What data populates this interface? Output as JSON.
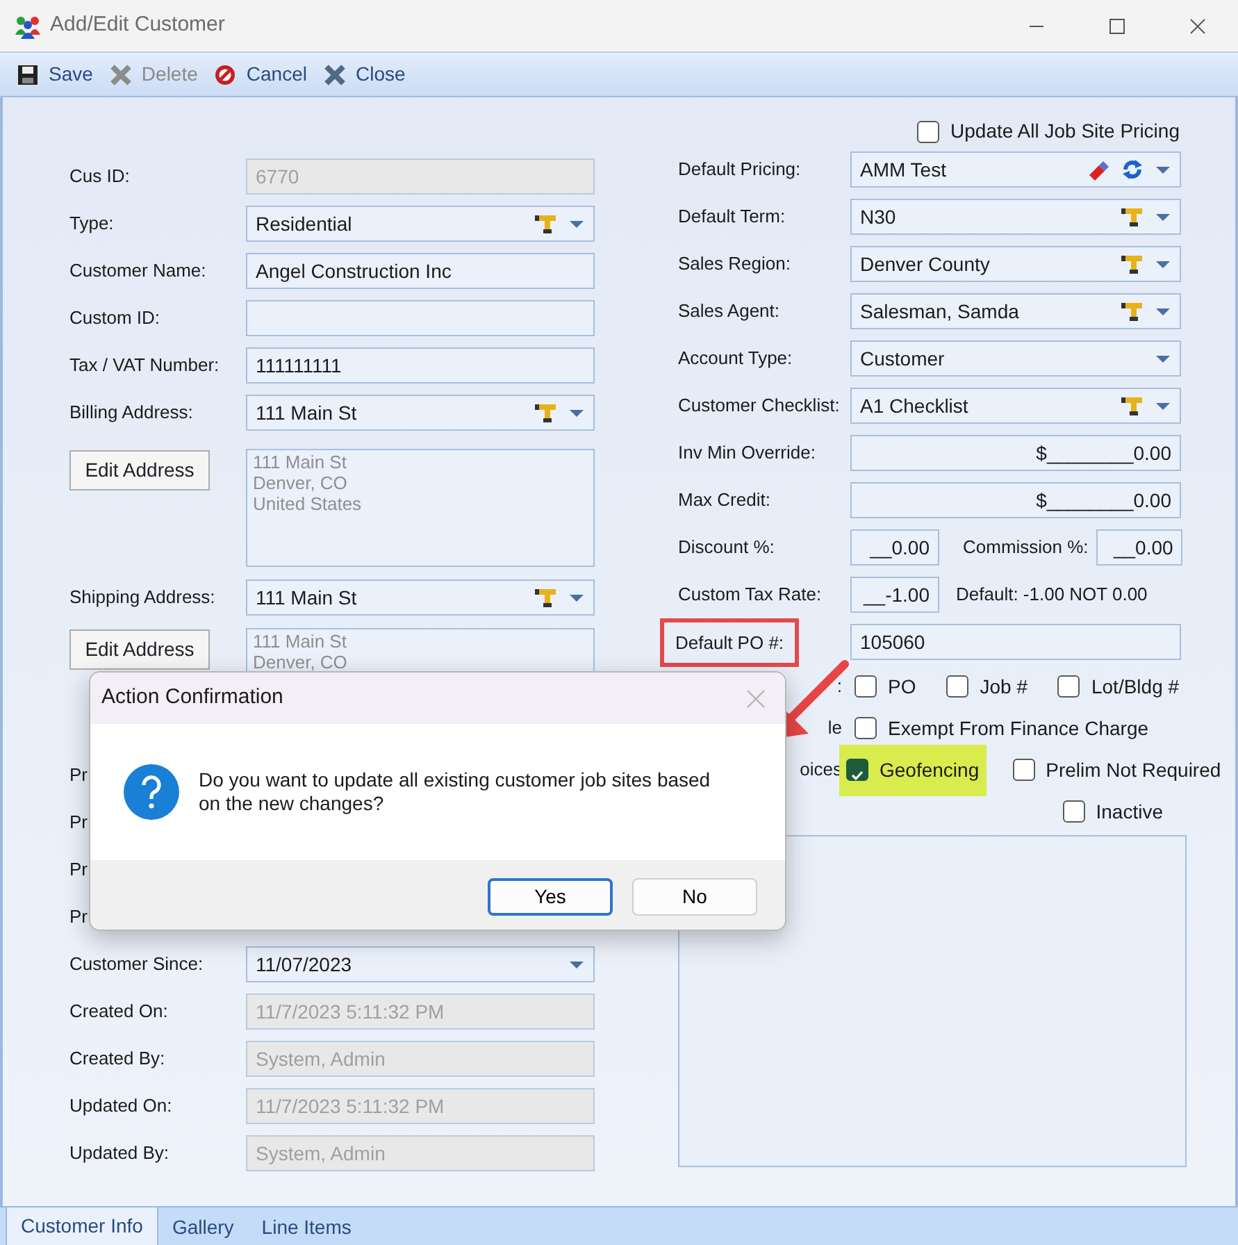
{
  "window": {
    "title": "Add/Edit Customer"
  },
  "toolbar": [
    {
      "label": "Save",
      "kind": "save",
      "disabled": false
    },
    {
      "label": "Delete",
      "kind": "delete",
      "disabled": true
    },
    {
      "label": "Cancel",
      "kind": "cancel",
      "disabled": false
    },
    {
      "label": "Close",
      "kind": "close",
      "disabled": false
    }
  ],
  "left_fields": [
    {
      "label": "Cus ID:",
      "kind": "readonly",
      "value": "6770"
    },
    {
      "label": "Type:",
      "kind": "combo_tool",
      "value": "Residential"
    },
    {
      "label": "Customer Name:",
      "kind": "text",
      "value": "Angel Construction Inc"
    },
    {
      "label": "Custom ID:",
      "kind": "text"
    },
    {
      "label": "Tax / VAT Number:",
      "kind": "text",
      "value": "111111111"
    },
    {
      "label": "Billing Address:",
      "kind": "combo_tool",
      "value": "111 Main St"
    },
    {
      "kind": "address",
      "button": "Edit Address",
      "lines": [
        "111 Main St",
        "Denver, CO",
        "United States"
      ]
    },
    {
      "label": "Shipping Address:",
      "kind": "combo_tool",
      "value": "111 Main St"
    },
    {
      "kind": "address",
      "button": "Edit Address",
      "lines": [
        "111 Main St",
        "Denver, CO"
      ]
    },
    {
      "label": "Pr",
      "kind": "covered"
    },
    {
      "label": "Pr",
      "kind": "covered"
    },
    {
      "label": "Pr",
      "kind": "covered"
    },
    {
      "label": "Pr",
      "kind": "covered"
    },
    {
      "label": "Customer Since:",
      "kind": "combo",
      "value": "11/07/2023"
    },
    {
      "label": "Created On:",
      "kind": "readonly",
      "value": "11/7/2023 5:11:32 PM"
    },
    {
      "label": "Created By:",
      "kind": "readonly",
      "value": "System, Admin"
    },
    {
      "label": "Updated On:",
      "kind": "readonly",
      "value": "11/7/2023 5:11:32 PM"
    },
    {
      "label": "Updated By:",
      "kind": "readonly",
      "value": "System, Admin"
    }
  ],
  "right_fields": [
    {
      "kind": "check_top",
      "checks": [
        {
          "label": "Update All Job Site Pricing",
          "checked": false,
          "highlighted": false
        }
      ]
    },
    {
      "label": "Default Pricing:",
      "kind": "combo_pricing",
      "value": "AMM Test"
    },
    {
      "label": "Default Term:",
      "kind": "combo_tool",
      "value": "N30"
    },
    {
      "label": "Sales Region:",
      "kind": "combo_tool",
      "value": "Denver County"
    },
    {
      "label": "Sales Agent:",
      "kind": "combo_tool",
      "value": "Salesman, Samda"
    },
    {
      "label": "Account Type:",
      "kind": "combo",
      "value": "Customer"
    },
    {
      "label": "Customer Checklist:",
      "kind": "combo_tool",
      "value": "A1 Checklist"
    },
    {
      "label": "Inv Min Override:",
      "kind": "money",
      "value": "$________0.00"
    },
    {
      "label": "Max Credit:",
      "kind": "money",
      "value": "$________0.00"
    },
    {
      "label": "Discount %:",
      "kind": "pair",
      "value": "__0.00",
      "label2": "Commission %:",
      "value2": "__0.00"
    },
    {
      "label": "Custom Tax Rate:",
      "kind": "note",
      "value": "__-1.00",
      "note": "Default: -1.00 NOT 0.00"
    },
    {
      "label": "Default PO #:",
      "kind": "text",
      "value": "105060",
      "boxed": true
    },
    {
      "label": ":",
      "kind": "checks",
      "checks": [
        {
          "label": "PO",
          "checked": false,
          "highlighted": false
        },
        {
          "label": "Job #",
          "checked": false,
          "highlighted": false
        },
        {
          "label": "Lot/Bldg #",
          "checked": false,
          "highlighted": false
        }
      ]
    },
    {
      "label": "le",
      "kind": "checks",
      "checks": [
        {
          "label": "Exempt From Finance Charge",
          "checked": false,
          "highlighted": false
        }
      ]
    },
    {
      "label": "oices",
      "kind": "checks",
      "checks": [
        {
          "label": "Geofencing",
          "checked": true,
          "highlighted": true
        },
        {
          "label": "Prelim Not Required",
          "checked": false,
          "highlighted": false
        }
      ]
    },
    {
      "kind": "check_end",
      "checks": [
        {
          "label": "Inactive",
          "checked": false,
          "highlighted": false
        }
      ]
    },
    {
      "kind": "panel"
    }
  ],
  "tabs": [
    {
      "label": "Customer Info",
      "selected": true
    },
    {
      "label": "Gallery",
      "selected": false
    },
    {
      "label": "Line Items",
      "selected": false
    }
  ],
  "dialog": {
    "title": "Action Confirmation",
    "message": "Do you want to update all existing customer job sites based on the new changes?",
    "buttons": [
      {
        "label": "Yes",
        "default": true
      },
      {
        "label": "No",
        "default": false
      }
    ]
  }
}
